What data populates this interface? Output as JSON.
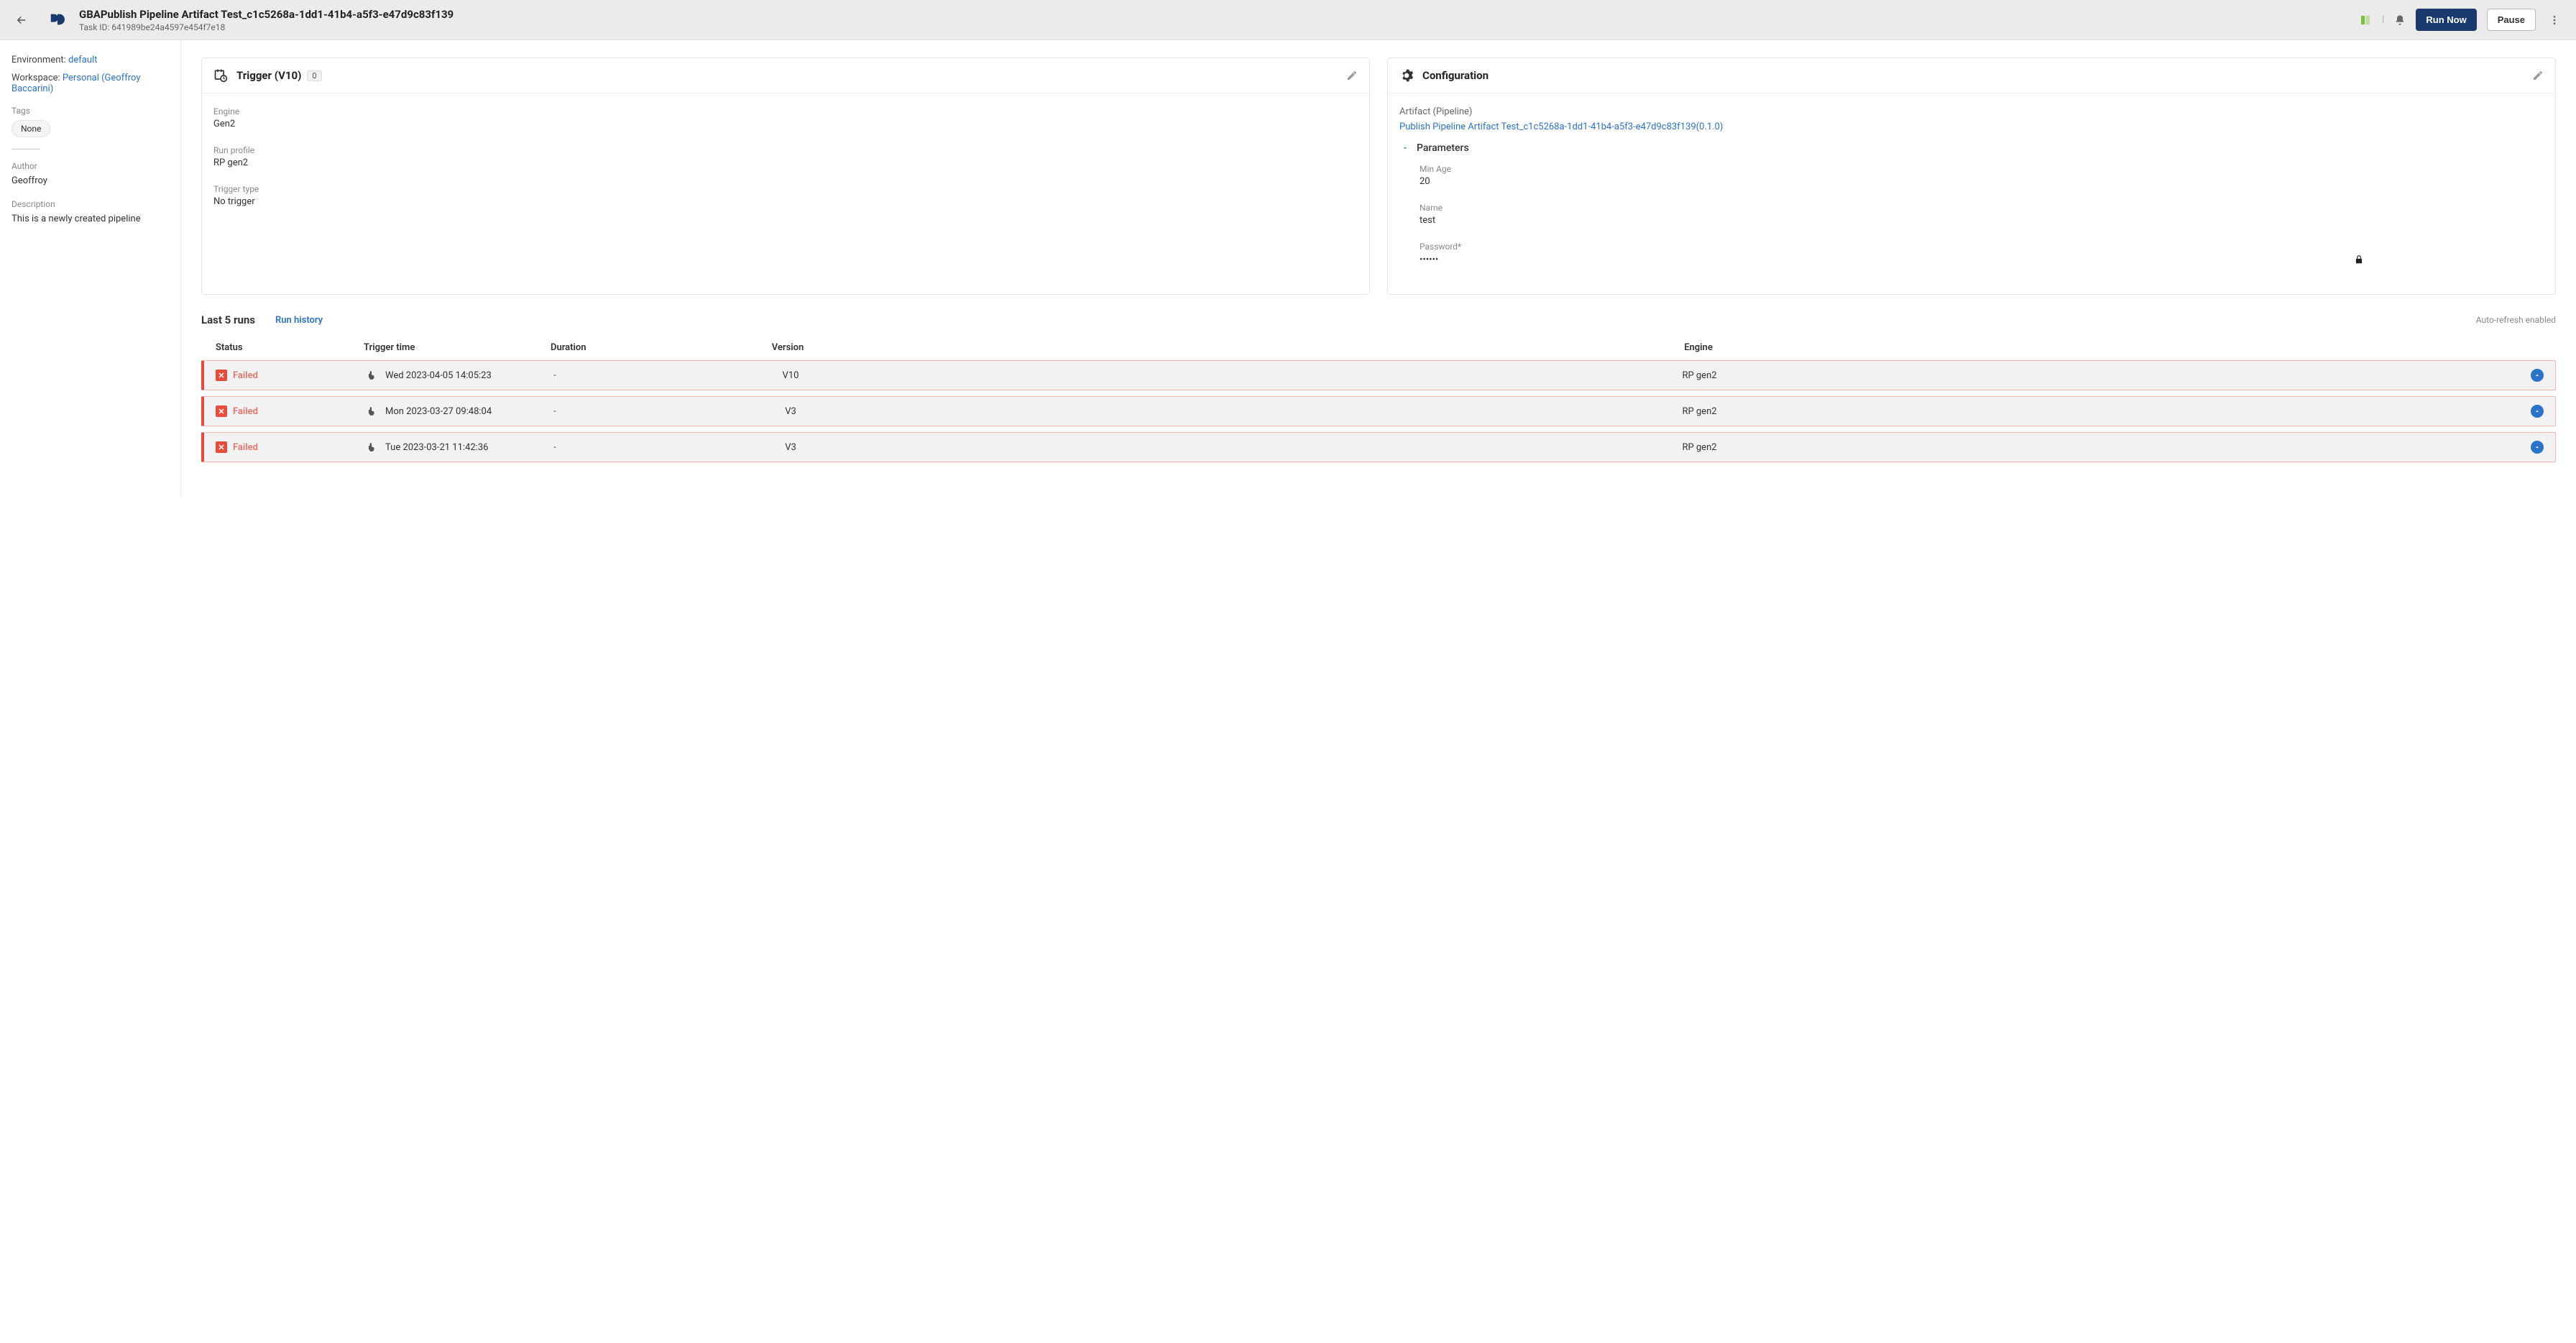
{
  "header": {
    "title": "GBAPublish Pipeline Artifact Test_c1c5268a-1dd1-41b4-a5f3-e47d9c83f139",
    "task_id_label": "Task ID: 641989be24a4597e454f7e18",
    "run_now": "Run Now",
    "pause": "Pause"
  },
  "sidebar": {
    "env_label": "Environment:",
    "env_value": "default",
    "ws_label": "Workspace:",
    "ws_value": "Personal (Geoffroy Baccarini)",
    "tags_label": "Tags",
    "tags_value": "None",
    "author_label": "Author",
    "author_value": "Geoffroy",
    "desc_label": "Description",
    "desc_value": "This is a newly created pipeline"
  },
  "trigger": {
    "title": "Trigger (V10)",
    "badge": "0",
    "engine_label": "Engine",
    "engine_value": "Gen2",
    "profile_label": "Run profile",
    "profile_value": "RP gen2",
    "type_label": "Trigger type",
    "type_value": "No trigger"
  },
  "config": {
    "title": "Configuration",
    "artifact_label": "Artifact (Pipeline)",
    "artifact_link": "Publish Pipeline Artifact Test_c1c5268a-1dd1-41b4-a5f3-e47d9c83f139(0.1.0)",
    "params_label": "Parameters",
    "min_age_label": "Min Age",
    "min_age_value": "20",
    "name_label": "Name",
    "name_value": "test",
    "password_label": "Password*",
    "password_value": "••••••"
  },
  "runs": {
    "title": "Last 5 runs",
    "history_link": "Run history",
    "auto_refresh": "Auto-refresh enabled",
    "columns": {
      "status": "Status",
      "trigger": "Trigger time",
      "duration": "Duration",
      "version": "Version",
      "engine": "Engine"
    },
    "rows": [
      {
        "status": "Failed",
        "trigger": "Wed 2023-04-05 14:05:23",
        "duration": "-",
        "version": "V10",
        "engine": "RP gen2"
      },
      {
        "status": "Failed",
        "trigger": "Mon 2023-03-27 09:48:04",
        "duration": "-",
        "version": "V3",
        "engine": "RP gen2"
      },
      {
        "status": "Failed",
        "trigger": "Tue 2023-03-21 11:42:36",
        "duration": "-",
        "version": "V3",
        "engine": "RP gen2"
      }
    ]
  }
}
